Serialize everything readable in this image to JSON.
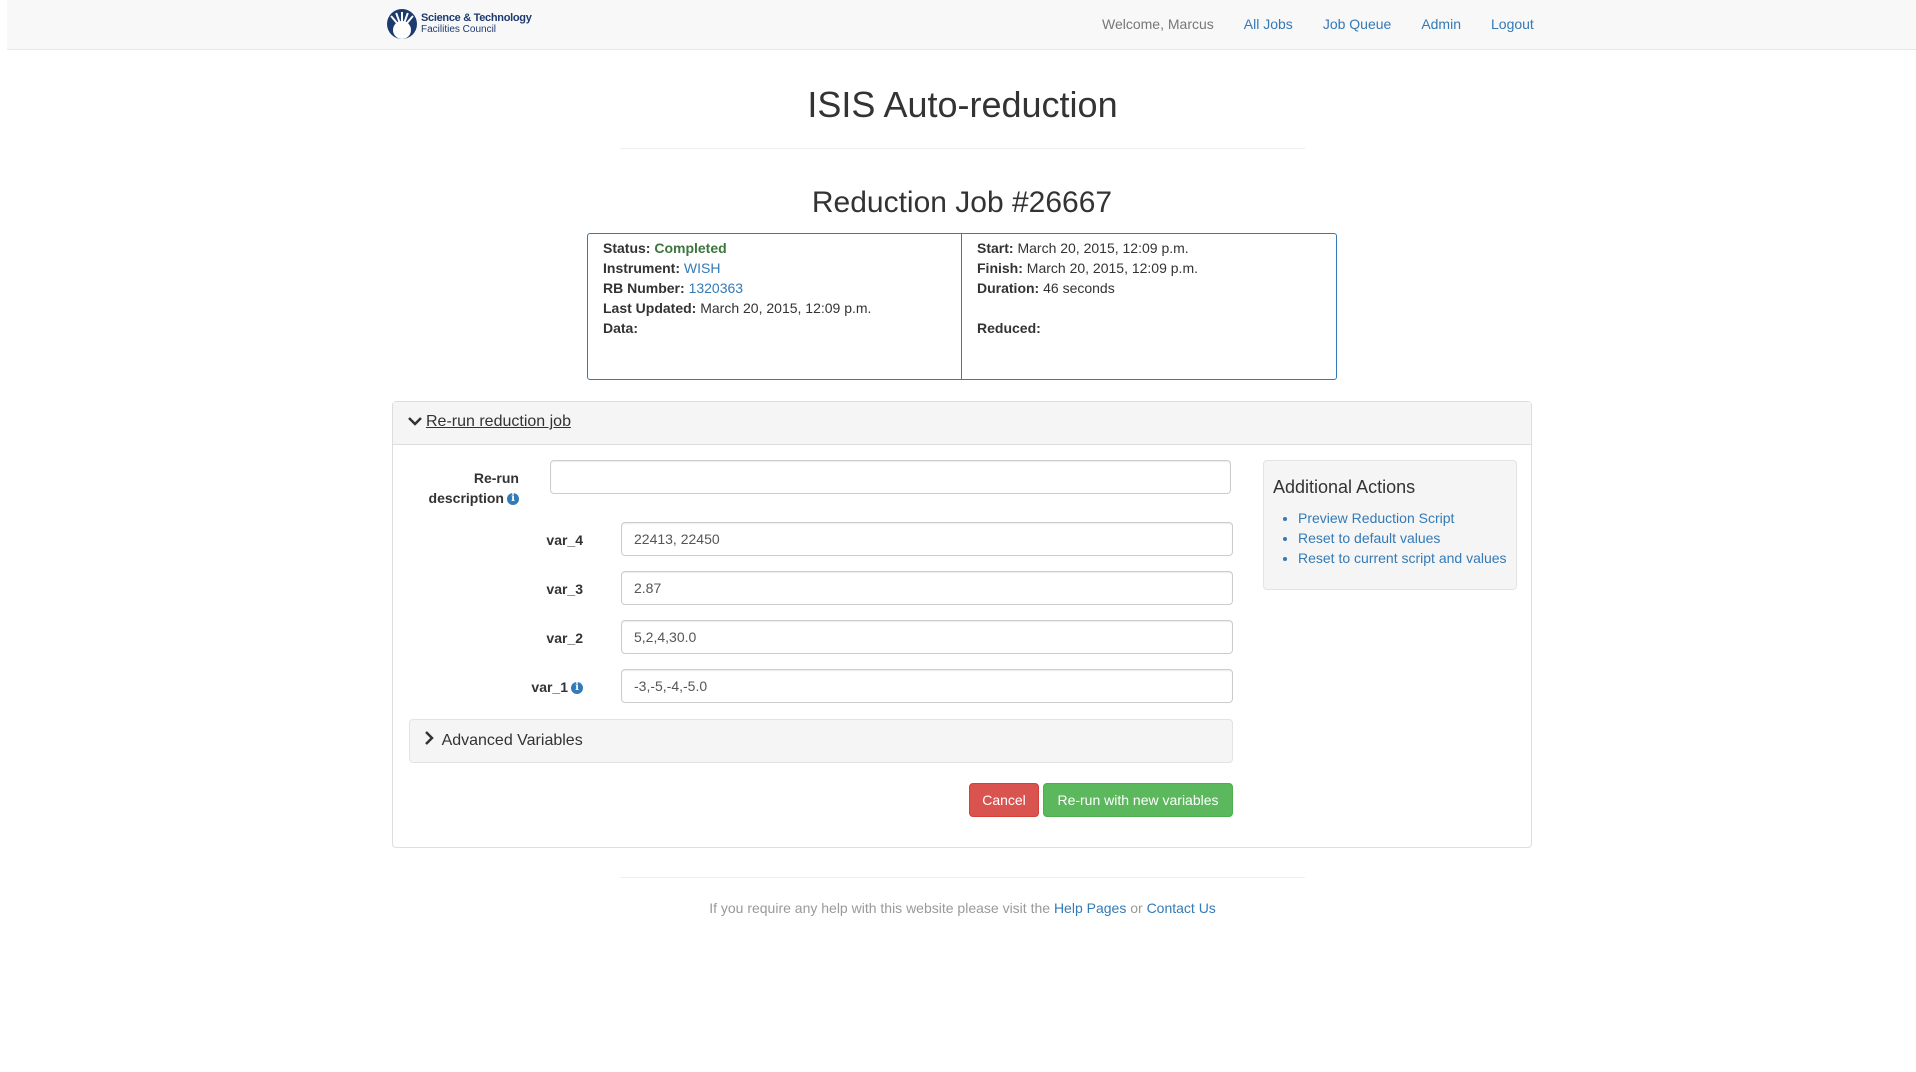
{
  "brand": {
    "line1": "Science & Technology",
    "line2": "Facilities Council"
  },
  "nav": {
    "welcome": "Welcome, Marcus",
    "links": [
      "All Jobs",
      "Job Queue",
      "Admin",
      "Logout"
    ]
  },
  "page_title": "ISIS Auto-reduction",
  "job_title": "Reduction Job #26667",
  "info": {
    "status_label": "Status:",
    "status_value": "Completed",
    "instrument_label": "Instrument:",
    "instrument_value": "WISH",
    "rb_label": "RB Number:",
    "rb_value": "1320363",
    "updated_label": "Last Updated:",
    "updated_value": "March 20, 2015, 12:09 p.m.",
    "data_label": "Data:",
    "start_label": "Start:",
    "start_value": "March 20, 2015, 12:09 p.m.",
    "finish_label": "Finish:",
    "finish_value": "March 20, 2015, 12:09 p.m.",
    "duration_label": "Duration:",
    "duration_value": "46 seconds",
    "reduced_label": "Reduced:"
  },
  "rerun": {
    "heading": "Re-run reduction job",
    "description_label_1": "Re-run",
    "description_label_2": "description",
    "description_value": "",
    "variables": [
      {
        "name": "var_4",
        "value": "22413, 22450"
      },
      {
        "name": "var_3",
        "value": "2.87"
      },
      {
        "name": "var_2",
        "value": "5,2,4,30.0"
      },
      {
        "name": "var_1",
        "value": "-3,-5,-4,-5.0"
      }
    ],
    "advanced_label": "Advanced Variables",
    "cancel_label": "Cancel",
    "submit_label": "Re-run with new variables"
  },
  "actions": {
    "title": "Additional Actions",
    "items": [
      "Preview Reduction Script",
      "Reset to default values",
      "Reset to current script and values"
    ]
  },
  "footer": {
    "text_before": "If you require any help with this website please visit the",
    "help_link": "Help Pages",
    "or": "or",
    "contact_link": "Contact Us"
  }
}
